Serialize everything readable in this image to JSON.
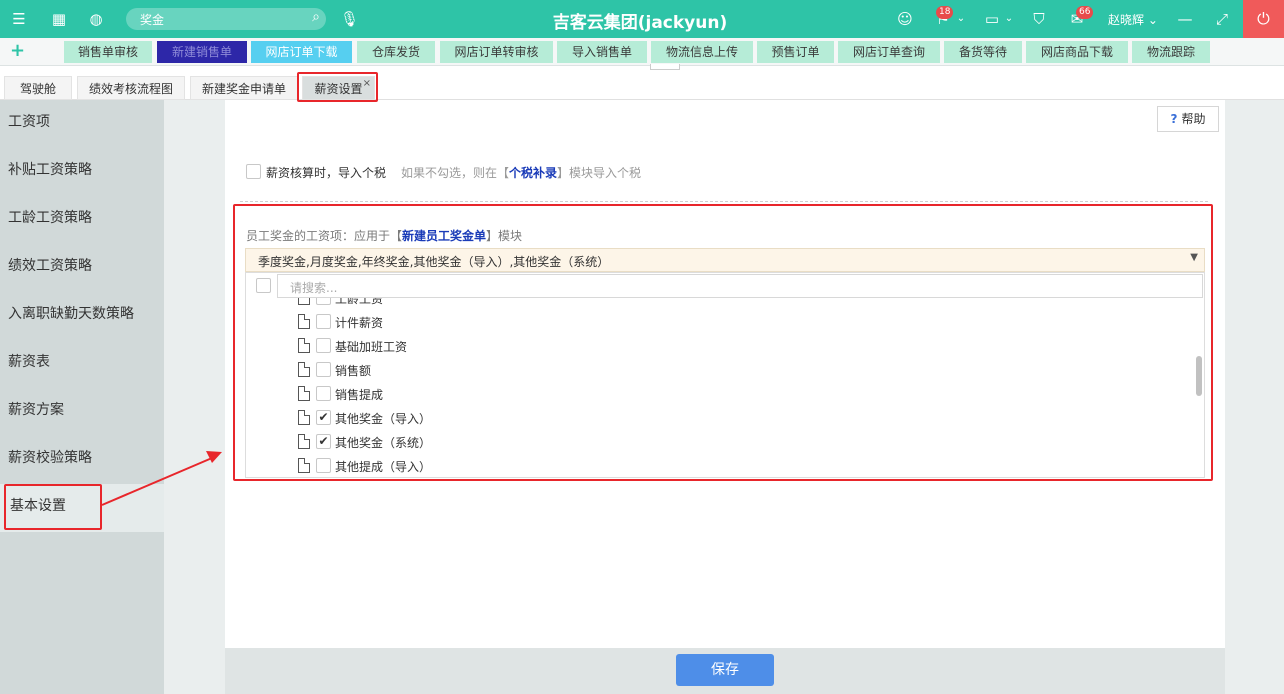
{
  "topbar": {
    "search_value": "奖金",
    "title": "吉客云集团(jackyun)",
    "badge_a": "18",
    "badge_b": "66",
    "user": "赵晓辉"
  },
  "quickbar": {
    "items": [
      "销售单审核",
      "新建销售单",
      "网店订单下载",
      "仓库发货",
      "网店订单转审核",
      "导入销售单",
      "物流信息上传",
      "预售订单",
      "网店订单查询",
      "备货等待",
      "网店商品下载",
      "物流跟踪"
    ]
  },
  "tabs": [
    "驾驶舱",
    "绩效考核流程图",
    "新建奖金申请单",
    "薪资设置"
  ],
  "sidebar": {
    "items": [
      "工资项",
      "补贴工资策略",
      "工龄工资策略",
      "绩效工资策略",
      "入离职缺勤天数策略",
      "薪资表",
      "薪资方案",
      "薪资校验策略",
      "基本设置"
    ]
  },
  "help": {
    "label": "帮助"
  },
  "tax_option": {
    "label": "薪资核算时，导入个税",
    "hint_prefix": "如果不勾选，则在【",
    "hint_link": "个税补录",
    "hint_suffix": "】模块导入个税"
  },
  "bonus": {
    "label_prefix": "员工奖金的工资项：",
    "label_gray": "应用于【",
    "label_link": "新建员工奖金单",
    "label_suffix": "】模块",
    "selected": "季度奖金,月度奖金,年终奖金,其他奖金（导入）,其他奖金（系统）",
    "search_placeholder": "请搜索...",
    "options": [
      {
        "label": "工龄工资",
        "checked": false
      },
      {
        "label": "计件薪资",
        "checked": false
      },
      {
        "label": "基础加班工资",
        "checked": false
      },
      {
        "label": "销售额",
        "checked": false
      },
      {
        "label": "销售提成",
        "checked": false
      },
      {
        "label": "其他奖金（导入）",
        "checked": true
      },
      {
        "label": "其他奖金（系统）",
        "checked": true
      },
      {
        "label": "其他提成（导入）",
        "checked": false
      }
    ]
  },
  "footer": {
    "save_label": "保存"
  },
  "colors": {
    "brand": "#2ec4a7",
    "highlight": "#e8262b",
    "primary_button": "#4e8ee8"
  }
}
